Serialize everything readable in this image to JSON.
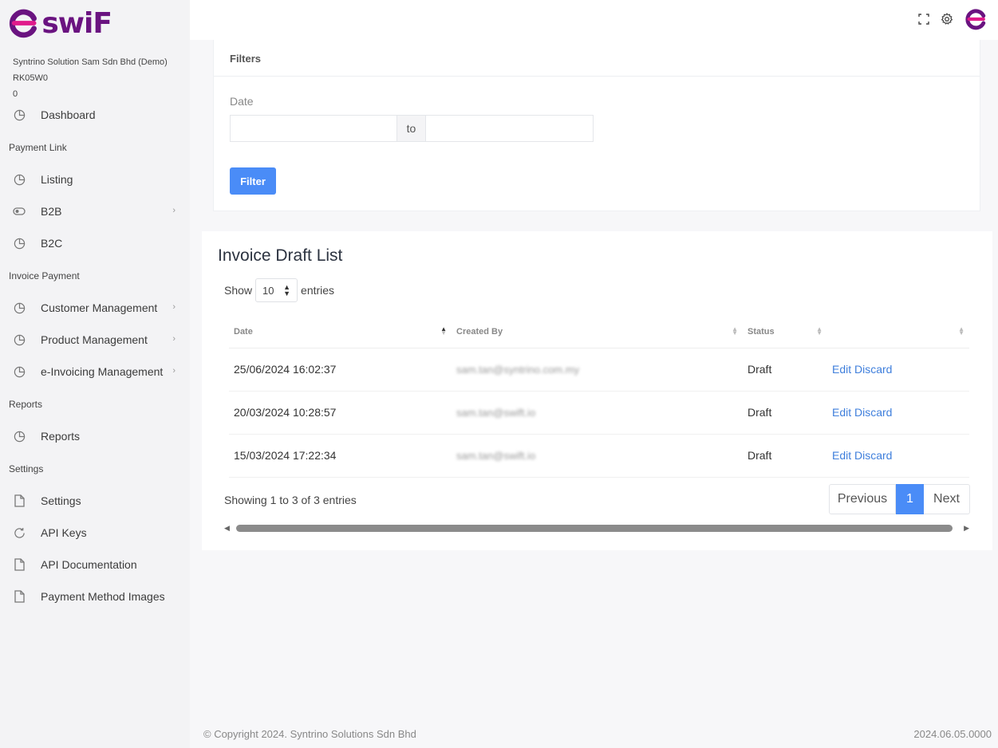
{
  "brand": {
    "name": "swiF",
    "primary_color": "#6a1380",
    "accent_color": "#e01a8a"
  },
  "org": {
    "name": "Syntrino Solution Sam Sdn Bhd (Demo)",
    "code": "RK05W0",
    "balance": "0"
  },
  "sidebar": {
    "dashboard": {
      "label": "Dashboard",
      "icon": "pie-chart-icon"
    },
    "sections": [
      {
        "title": "Payment Link",
        "items": [
          {
            "label": "Listing",
            "icon": "pie-chart-icon",
            "chevron": false
          },
          {
            "label": "B2B",
            "icon": "toggle-icon",
            "chevron": true
          },
          {
            "label": "B2C",
            "icon": "pie-chart-icon",
            "chevron": false
          }
        ]
      },
      {
        "title": "Invoice Payment",
        "items": [
          {
            "label": "Customer Management",
            "icon": "pie-chart-icon",
            "chevron": true
          },
          {
            "label": "Product Management",
            "icon": "pie-chart-icon",
            "chevron": true
          },
          {
            "label": "e-Invoicing Management",
            "icon": "pie-chart-icon",
            "chevron": true
          }
        ]
      },
      {
        "title": "Reports",
        "items": [
          {
            "label": "Reports",
            "icon": "pie-chart-icon",
            "chevron": false
          }
        ]
      },
      {
        "title": "Settings",
        "items": [
          {
            "label": "Settings",
            "icon": "file-icon",
            "chevron": false
          },
          {
            "label": "API Keys",
            "icon": "refresh-icon",
            "chevron": false
          },
          {
            "label": "API Documentation",
            "icon": "file-icon",
            "chevron": false
          },
          {
            "label": "Payment Method Images",
            "icon": "file-icon",
            "chevron": false
          }
        ]
      }
    ]
  },
  "filters": {
    "title": "Filters",
    "date_label": "Date",
    "date_from": "",
    "date_to": "",
    "to_label": "to",
    "filter_button": "Filter"
  },
  "list": {
    "title": "Invoice Draft List",
    "show_label": "Show",
    "entries_value": "10",
    "entries_label": "entries",
    "columns": [
      "Date",
      "Created By",
      "Status",
      ""
    ],
    "rows": [
      {
        "date": "25/06/2024 16:02:37",
        "created_by": "sam.tan@syntrino.com.my",
        "status": "Draft",
        "edit": "Edit",
        "discard": "Discard"
      },
      {
        "date": "20/03/2024 10:28:57",
        "created_by": "sam.tan@swift.io",
        "status": "Draft",
        "edit": "Edit",
        "discard": "Discard"
      },
      {
        "date": "15/03/2024 17:22:34",
        "created_by": "sam.tan@swift.io",
        "status": "Draft",
        "edit": "Edit",
        "discard": "Discard"
      }
    ],
    "showing": "Showing 1 to 3 of 3 entries",
    "pager": {
      "previous": "Previous",
      "current": "1",
      "next": "Next"
    }
  },
  "footer": {
    "copyright": "© Copyright 2024. Syntrino Solutions Sdn Bhd",
    "version": "2024.06.05.0000"
  }
}
